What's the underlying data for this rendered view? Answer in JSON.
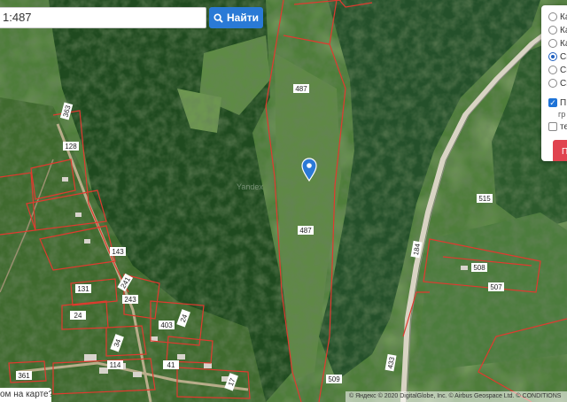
{
  "search": {
    "value": "1:487",
    "button_label": "Найти",
    "button_color": "#2a7ad6"
  },
  "layer_panel": {
    "options": [
      {
        "label": "Ка",
        "selected": false
      },
      {
        "label": "Ка",
        "selected": false
      },
      {
        "label": "Ка",
        "selected": false
      },
      {
        "label": "Сп",
        "selected": true
      },
      {
        "label": "Сп",
        "selected": false
      },
      {
        "label": "Сп",
        "selected": false
      }
    ],
    "checkbox_1": {
      "label": "П",
      "sublabel": "гр",
      "checked": true
    },
    "checkbox_2": {
      "label": "те",
      "checked": false
    },
    "apply_label": "П",
    "apply_color": "#e0434f"
  },
  "map": {
    "watermark": "Yandex",
    "parcel_labels": [
      "487",
      "487",
      "515",
      "184",
      "508",
      "507",
      "433",
      "509",
      "128",
      "143",
      "131",
      "24",
      "241",
      "243",
      "403",
      "24",
      "34",
      "114",
      "41",
      "17",
      "361",
      "363"
    ],
    "parcel_color": "#e03a2f",
    "marker_color": "#2b79d6"
  },
  "bottom_question": "ом на карте?",
  "copyright": "© Яндекс © 2020 DigitalGlobe, Inc. © Airbus Geospace Ltd. © CONDITIONS"
}
